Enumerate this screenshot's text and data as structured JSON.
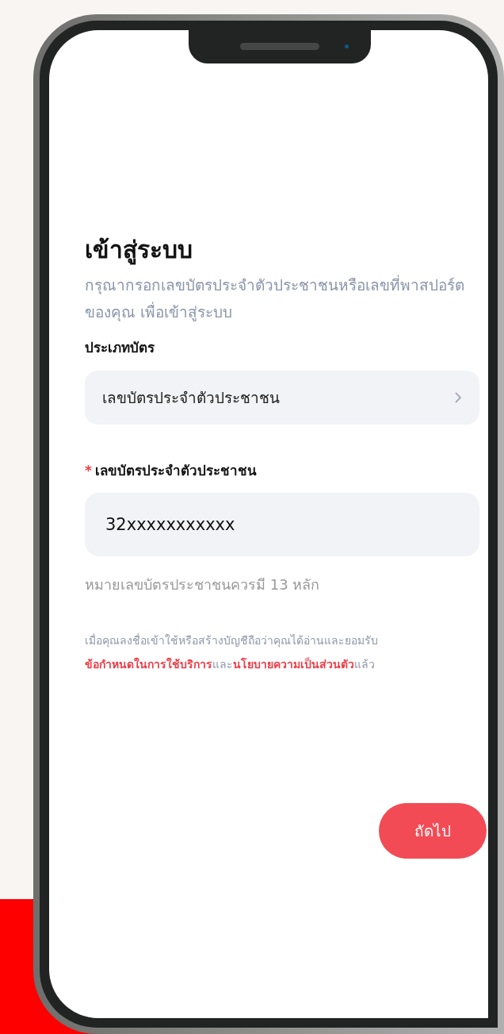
{
  "title": "เข้าสู่ระบบ",
  "subtitle": "กรุณากรอกเลขบัตรประจำตัวประชาชนหรือเลขที่พาสปอร์ตของคุณ เพื่อเข้าสู่ระบบ",
  "card_type": {
    "label": "ประเภทบัตร",
    "value": "เลขบัตรประจำตัวประชาชน"
  },
  "id_field": {
    "label": "เลขบัตรประจำตัวประชาชน",
    "required": true,
    "required_mark": "*",
    "value": "32xxxxxxxxxxx",
    "helper": "หมายเลขบัตรประชาชนควรมี 13 หลัก"
  },
  "terms": [
    {
      "kind": "text",
      "text": "เมื่อคุณลงชื่อเข้าใช้หรือสร้างบัญชีถือว่าคุณได้อ่านและยอมรับ"
    },
    {
      "kind": "link",
      "text": "ข้อกำหนดในการใช้บริการ"
    },
    {
      "kind": "text",
      "text": "และ"
    },
    {
      "kind": "link",
      "text": "นโยบายความเป็นส่วนตัว"
    },
    {
      "kind": "text",
      "text": "แล้ว"
    }
  ],
  "next_button": "ถัดไป"
}
